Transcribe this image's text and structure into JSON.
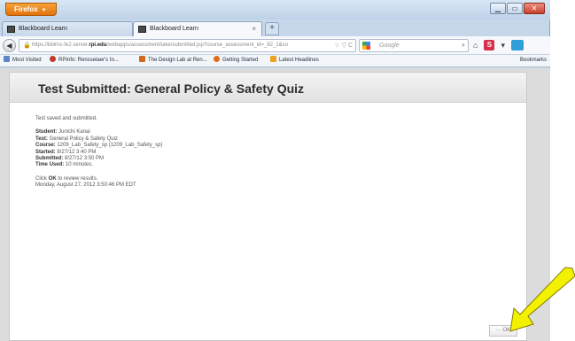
{
  "browser": {
    "app_button": "Firefox",
    "tabs": [
      {
        "label": "Blackboard Learn"
      },
      {
        "label": "Blackboard Learn"
      }
    ],
    "new_tab": "+",
    "url_prefix": "https://bblrnc-fe2.server.",
    "url_domain": "rpi.edu",
    "url_suffix": "/webapps/assessment/take/submitted.jsp?course_assessment_id=_82_1&co",
    "search_placeholder": "Google",
    "bookmarks": [
      {
        "label": "Most Visited"
      },
      {
        "label": "RPInfo: Rensselaer's In..."
      },
      {
        "label": "The Design Lab at Ren..."
      },
      {
        "label": "Getting Started"
      },
      {
        "label": "Latest Headlines"
      }
    ],
    "bookmarks_menu": "Bookmarks"
  },
  "page": {
    "title": "Test Submitted: General Policy & Safety Quiz",
    "status": "Test saved and submitted.",
    "details": [
      {
        "label": "Student:",
        "value": "Junichi Kanai"
      },
      {
        "label": "Test:",
        "value": "General Policy & Safety Quiz"
      },
      {
        "label": "Course:",
        "value": "1209_Lab_Safety_sp (1209_Lab_Safety_sp)"
      },
      {
        "label": "Started:",
        "value": "8/27/12 3:40 PM"
      },
      {
        "label": "Submitted:",
        "value": "8/27/12 3:50 PM"
      },
      {
        "label": "Time Used:",
        "value": "10 minutes."
      }
    ],
    "click_prefix": "Click",
    "click_ok": "OK",
    "click_suffix": "to review results.",
    "timestamp": "Monday, August 27, 2012 3:50:46 PM EDT",
    "ok_prefix": "---",
    "ok_label": "OK"
  },
  "colors": {
    "firefox_button": "#e0730c",
    "arrow_fill": "#f2f200",
    "arrow_stroke": "#8a7a00"
  }
}
